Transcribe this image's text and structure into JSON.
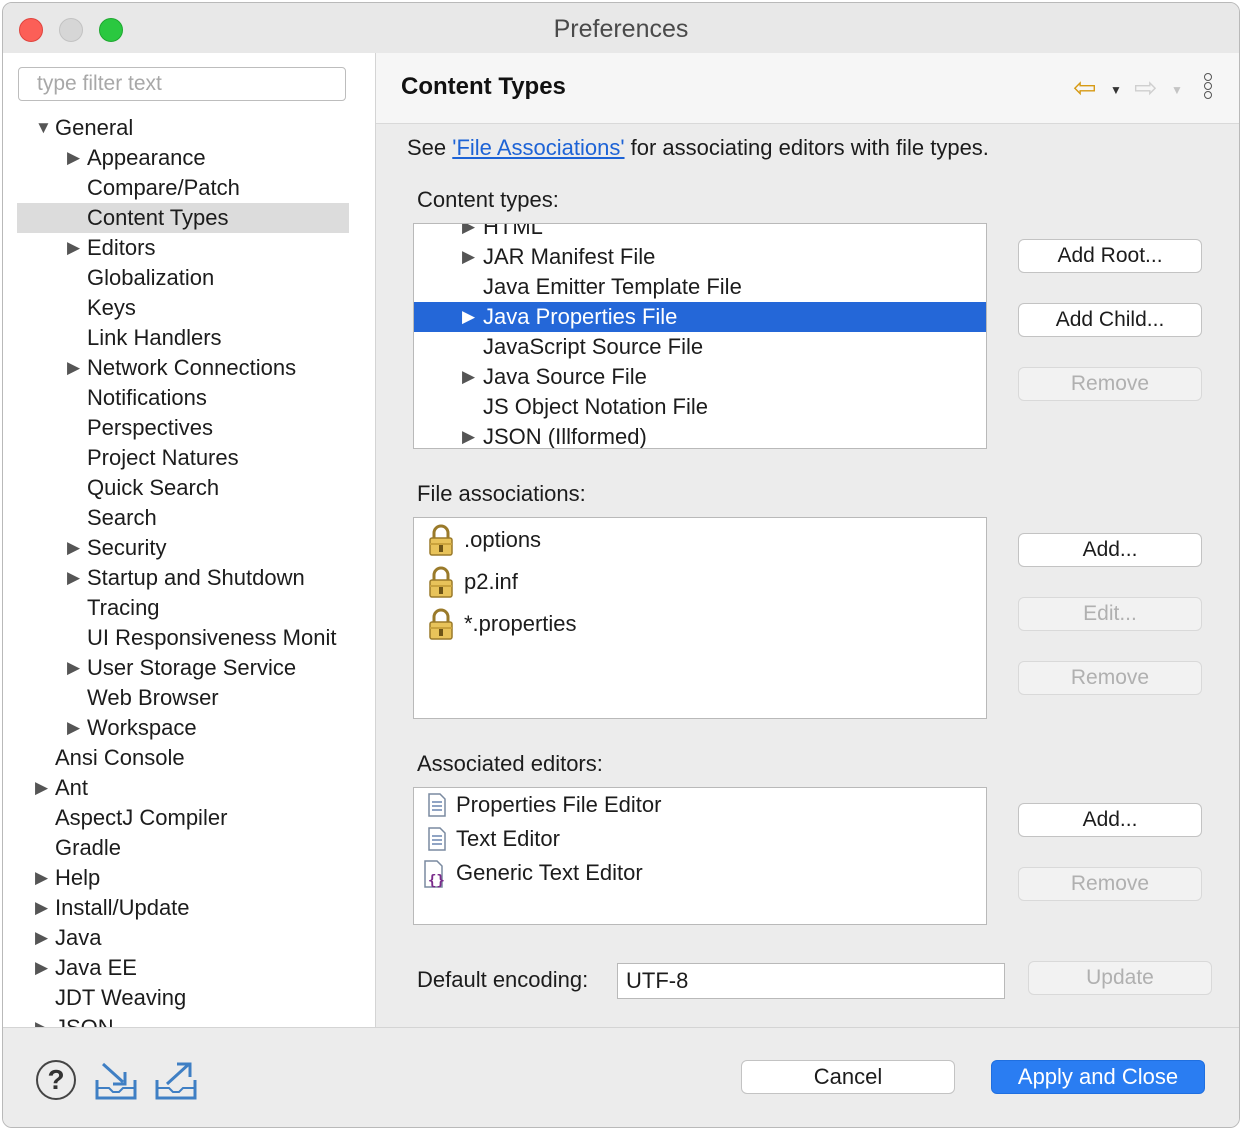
{
  "window": {
    "title": "Preferences"
  },
  "sidebar": {
    "filter_placeholder": "type filter text",
    "items": [
      {
        "label": "General",
        "expandable": true,
        "expanded": true,
        "level": 0
      },
      {
        "label": "Appearance",
        "expandable": true,
        "level": 1
      },
      {
        "label": "Compare/Patch",
        "expandable": false,
        "level": 1
      },
      {
        "label": "Content Types",
        "expandable": false,
        "level": 1,
        "selected": true
      },
      {
        "label": "Editors",
        "expandable": true,
        "level": 1
      },
      {
        "label": "Globalization",
        "expandable": false,
        "level": 1
      },
      {
        "label": "Keys",
        "expandable": false,
        "level": 1
      },
      {
        "label": "Link Handlers",
        "expandable": false,
        "level": 1
      },
      {
        "label": "Network Connections",
        "expandable": true,
        "level": 1
      },
      {
        "label": "Notifications",
        "expandable": false,
        "level": 1
      },
      {
        "label": "Perspectives",
        "expandable": false,
        "level": 1
      },
      {
        "label": "Project Natures",
        "expandable": false,
        "level": 1
      },
      {
        "label": "Quick Search",
        "expandable": false,
        "level": 1
      },
      {
        "label": "Search",
        "expandable": false,
        "level": 1
      },
      {
        "label": "Security",
        "expandable": true,
        "level": 1
      },
      {
        "label": "Startup and Shutdown",
        "expandable": true,
        "level": 1
      },
      {
        "label": "Tracing",
        "expandable": false,
        "level": 1
      },
      {
        "label": "UI Responsiveness Monit",
        "expandable": false,
        "level": 1
      },
      {
        "label": "User Storage Service",
        "expandable": true,
        "level": 1
      },
      {
        "label": "Web Browser",
        "expandable": false,
        "level": 1
      },
      {
        "label": "Workspace",
        "expandable": true,
        "level": 1
      },
      {
        "label": "Ansi Console",
        "expandable": false,
        "level": 0
      },
      {
        "label": "Ant",
        "expandable": true,
        "level": 0
      },
      {
        "label": "AspectJ Compiler",
        "expandable": false,
        "level": 0
      },
      {
        "label": "Gradle",
        "expandable": false,
        "level": 0
      },
      {
        "label": "Help",
        "expandable": true,
        "level": 0
      },
      {
        "label": "Install/Update",
        "expandable": true,
        "level": 0
      },
      {
        "label": "Java",
        "expandable": true,
        "level": 0
      },
      {
        "label": "Java EE",
        "expandable": true,
        "level": 0
      },
      {
        "label": "JDT Weaving",
        "expandable": false,
        "level": 0
      },
      {
        "label": "JSON",
        "expandable": true,
        "level": 0
      }
    ]
  },
  "main": {
    "title": "Content Types",
    "description": {
      "prefix": "See ",
      "link": "'File Associations'",
      "suffix": " for associating editors with file types."
    },
    "content_types": {
      "label": "Content types:",
      "items": [
        {
          "label": "HTML",
          "expandable": true
        },
        {
          "label": "JAR Manifest File",
          "expandable": true
        },
        {
          "label": "Java Emitter Template File",
          "expandable": false
        },
        {
          "label": "Java Properties File",
          "expandable": true,
          "selected": true
        },
        {
          "label": "JavaScript Source File",
          "expandable": false
        },
        {
          "label": "Java Source File",
          "expandable": true
        },
        {
          "label": "JS Object Notation File",
          "expandable": false
        },
        {
          "label": "JSON (Illformed)",
          "expandable": true
        }
      ],
      "buttons": {
        "add_root": "Add Root...",
        "add_child": "Add Child...",
        "remove": "Remove"
      }
    },
    "file_associations": {
      "label": "File associations:",
      "items": [
        {
          "label": ".options",
          "icon": "lock-icon"
        },
        {
          "label": "p2.inf",
          "icon": "lock-icon"
        },
        {
          "label": "*.properties",
          "icon": "lock-icon"
        }
      ],
      "buttons": {
        "add": "Add...",
        "edit": "Edit...",
        "remove": "Remove"
      }
    },
    "associated_editors": {
      "label": "Associated editors:",
      "items": [
        {
          "label": "Properties File Editor",
          "icon": "document-icon"
        },
        {
          "label": "Text Editor",
          "icon": "document-icon"
        },
        {
          "label": "Generic Text Editor",
          "icon": "generic-editor-icon"
        }
      ],
      "buttons": {
        "add": "Add...",
        "remove": "Remove"
      }
    },
    "encoding": {
      "label": "Default encoding:",
      "value": "UTF-8",
      "update": "Update"
    }
  },
  "footer": {
    "cancel": "Cancel",
    "apply": "Apply and Close"
  },
  "colors": {
    "selection": "#2467d8",
    "primary_button": "#2a7df2",
    "link": "#1d63d6",
    "close": "#fc5f57",
    "maximize": "#2ac840"
  }
}
